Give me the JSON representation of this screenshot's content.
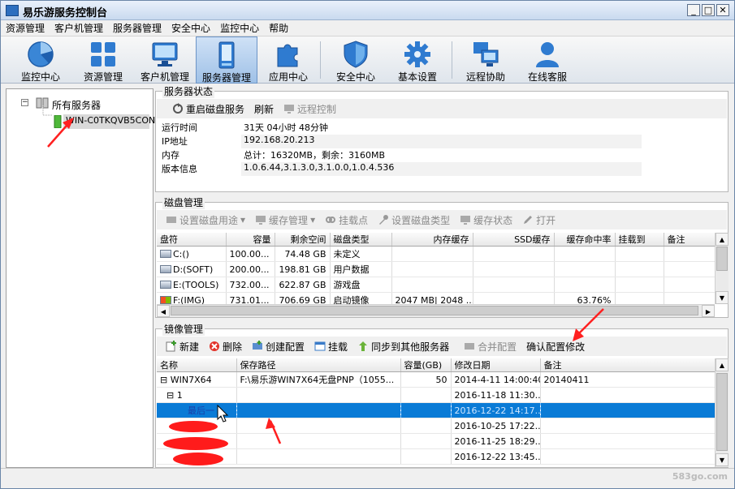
{
  "window": {
    "title": "易乐游服务控制台",
    "min": "_",
    "max": "□",
    "close": "✕"
  },
  "menu": [
    "资源管理",
    "客户机管理",
    "服务器管理",
    "安全中心",
    "监控中心",
    "帮助"
  ],
  "toolbar": [
    {
      "label": "监控中心",
      "icon": "pie-chart-icon"
    },
    {
      "label": "资源管理",
      "icon": "grid-icon"
    },
    {
      "label": "客户机管理",
      "icon": "monitor-icon"
    },
    {
      "label": "服务器管理",
      "icon": "server-icon",
      "active": true
    },
    {
      "label": "应用中心",
      "icon": "puzzle-icon"
    },
    {
      "label": "安全中心",
      "icon": "shield-icon"
    },
    {
      "label": "基本设置",
      "icon": "gear-icon"
    },
    {
      "label": "远程协助",
      "icon": "remote-screen-icon"
    },
    {
      "label": "在线客服",
      "icon": "user-icon"
    }
  ],
  "tree": {
    "root": "所有服务器",
    "toggle": "−",
    "node": "WIN-C0TKQVB5CON"
  },
  "server_status": {
    "title": "服务器状态",
    "actions": {
      "restart": "重启磁盘服务",
      "refresh": "刷新",
      "remote": "远程控制"
    },
    "rows": [
      {
        "key": "运行时间",
        "value": "31天 04小时 48分钟"
      },
      {
        "key": "IP地址",
        "value": "192.168.20.213"
      },
      {
        "key": "内存",
        "value": "总计：16320MB，剩余：3160MB"
      },
      {
        "key": "版本信息",
        "value": "1.0.6.44,3.1.3.0,3.1.0.0,1.0.4.536"
      }
    ]
  },
  "disk": {
    "title": "磁盘管理",
    "actions": {
      "set_usage": "设置磁盘用途",
      "cache_mgmt": "缓存管理",
      "mount": "挂载点",
      "set_type": "设置磁盘类型",
      "cache_status": "缓存状态",
      "open": "打开"
    },
    "columns": [
      "盘符",
      "容量",
      "剩余空间",
      "磁盘类型",
      "内存缓存",
      "SSD缓存",
      "缓存命中率",
      "挂载到",
      "备注"
    ],
    "rows": [
      [
        "C:()",
        "100.00...",
        "74.48 GB",
        "未定义",
        "",
        "",
        "",
        "",
        ""
      ],
      [
        "D:(SOFT)",
        "200.00...",
        "198.81 GB",
        "用户数据",
        "",
        "",
        "",
        "",
        ""
      ],
      [
        "E:(TOOLS)",
        "732.00...",
        "622.87 GB",
        "游戏盘",
        "",
        "",
        "",
        "",
        ""
      ],
      [
        "F:(IMG)",
        "731.01...",
        "706.69 GB",
        "启动镜像",
        "2047 MB| 2048 ...",
        "",
        "63.76%",
        "",
        ""
      ]
    ]
  },
  "image": {
    "title": "镜像管理",
    "actions": {
      "new": "新建",
      "delete": "删除",
      "create_cfg": "创建配置",
      "mount": "挂载",
      "sync": "同步到其他服务器",
      "merge": "合并配置",
      "confirm": "确认配置修改"
    },
    "columns": [
      "名称",
      "保存路径",
      "容量(GB)",
      "修改日期",
      "备注"
    ],
    "rows": [
      {
        "name": "WIN7X64",
        "toggle": "⊟",
        "path": "F:\\易乐游WIN7X64无盘PNP（1055...",
        "size": "50",
        "date": "2014-4-11 14:00:40",
        "note": "20140411"
      },
      {
        "name": "1",
        "toggle": "⊟",
        "path": "",
        "size": "",
        "date": "2016-11-18 11:30...",
        "note": ""
      },
      {
        "name": "最后一",
        "path": "",
        "size": "",
        "date": "2016-12-22 14:17...",
        "note": "",
        "selected": true
      },
      {
        "name": "",
        "path": "",
        "size": "",
        "date": "2016-10-25 17:22...",
        "note": ""
      },
      {
        "name": "",
        "path": "",
        "size": "",
        "date": "2016-11-25 18:29...",
        "note": ""
      },
      {
        "name": "",
        "path": "",
        "size": "",
        "date": "2016-12-22 13:45...",
        "note": ""
      }
    ]
  },
  "watermark": "583go.com",
  "colors": {
    "selection": "#0a7bd6",
    "annotation": "#ff2020",
    "accent": "#2d6fbf"
  }
}
